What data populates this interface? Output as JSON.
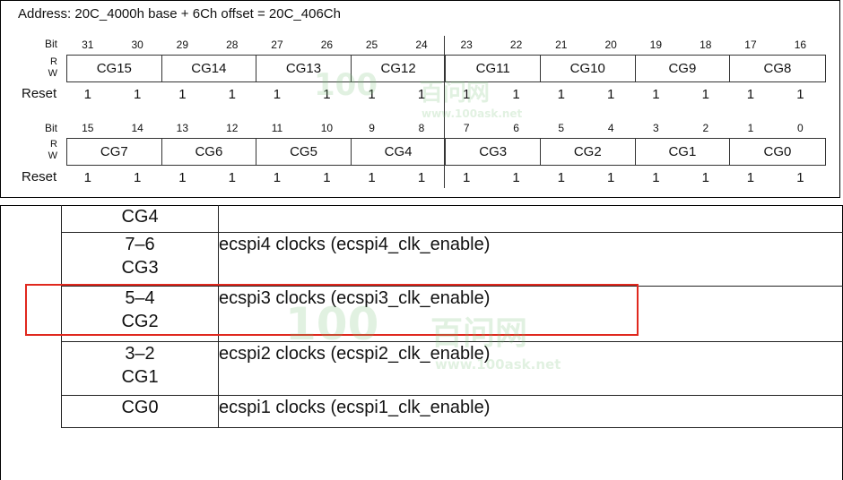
{
  "register": {
    "address": "Address: 20C_4000h base + 6Ch offset = 20C_406Ch",
    "bit_label": "Bit",
    "r_label": "R",
    "w_label": "W",
    "reset_label": "Reset",
    "upper": {
      "bits": [
        "31",
        "30",
        "29",
        "28",
        "27",
        "26",
        "25",
        "24",
        "23",
        "22",
        "21",
        "20",
        "19",
        "18",
        "17",
        "16"
      ],
      "fields": [
        "CG15",
        "CG14",
        "CG13",
        "CG12",
        "CG11",
        "CG10",
        "CG9",
        "CG8"
      ],
      "reset": [
        "1",
        "1",
        "1",
        "1",
        "1",
        "1",
        "1",
        "1",
        "1",
        "1",
        "1",
        "1",
        "1",
        "1",
        "1",
        "1"
      ]
    },
    "lower": {
      "bits": [
        "15",
        "14",
        "13",
        "12",
        "11",
        "10",
        "9",
        "8",
        "7",
        "6",
        "5",
        "4",
        "3",
        "2",
        "1",
        "0"
      ],
      "fields": [
        "CG7",
        "CG6",
        "CG5",
        "CG4",
        "CG3",
        "CG2",
        "CG1",
        "CG0"
      ],
      "reset": [
        "1",
        "1",
        "1",
        "1",
        "1",
        "1",
        "1",
        "1",
        "1",
        "1",
        "1",
        "1",
        "1",
        "1",
        "1",
        "1"
      ]
    }
  },
  "field_table": {
    "rows": [
      {
        "lines": [
          "CG4"
        ],
        "desc": ""
      },
      {
        "lines": [
          "7–6",
          "CG3"
        ],
        "desc": "ecspi4 clocks (ecspi4_clk_enable)"
      },
      {
        "lines": [
          "5–4",
          "CG2"
        ],
        "desc": "ecspi3 clocks (ecspi3_clk_enable)"
      },
      {
        "lines": [
          "3–2",
          "CG1"
        ],
        "desc": "ecspi2 clocks (ecspi2_clk_enable)"
      },
      {
        "lines": [
          "CG0"
        ],
        "desc": "ecspi1 clocks (ecspi1_clk_enable)"
      }
    ]
  },
  "highlight": {
    "color": "#e0281e"
  },
  "watermark": {
    "logo": "100",
    "cn": "百问网",
    "url": "www.100ask.net",
    "color": "#78be78"
  }
}
